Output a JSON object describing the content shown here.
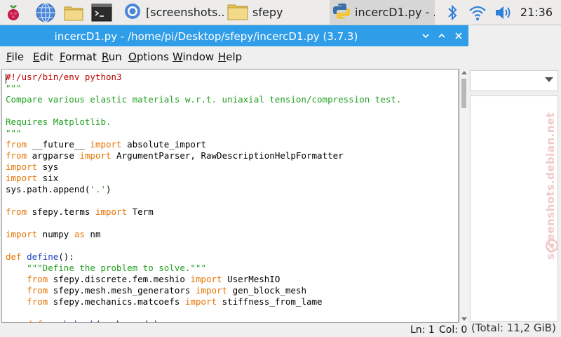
{
  "taskbar": {
    "tasks": [
      {
        "label": "[screenshots....",
        "icon": "chromium-icon"
      },
      {
        "label": "sfepy",
        "icon": "folder-icon"
      },
      {
        "label": "incercD1.py - ...",
        "icon": "python-icon"
      }
    ],
    "clock": "21:36",
    "launchers": [
      "raspberry-menu-icon",
      "web-browser-icon",
      "file-manager-icon",
      "terminal-icon"
    ],
    "tray": [
      "bluetooth-icon",
      "wifi-icon",
      "volume-icon"
    ]
  },
  "window": {
    "title": "incercD1.py - /home/pi/Desktop/sfepy/incercD1.py (3.7.3)",
    "menu": [
      {
        "label": "File",
        "key": "F",
        "rest": "ile"
      },
      {
        "label": "Edit",
        "key": "E",
        "rest": "dit"
      },
      {
        "label": "Format",
        "key": "F",
        "rest": "ormat"
      },
      {
        "label": "Run",
        "key": "R",
        "rest": "un"
      },
      {
        "label": "Options",
        "key": "O",
        "rest": "ptions"
      },
      {
        "label": "Window",
        "key": "W",
        "rest": "indow"
      },
      {
        "label": "Help",
        "key": "H",
        "rest": "elp"
      }
    ],
    "status": {
      "line": "Ln: 1",
      "col": "Col: 0"
    }
  },
  "editor": {
    "lines": [
      [
        [
          "cm",
          "#!/usr/bin/env python3"
        ]
      ],
      [
        [
          "st",
          "\"\"\""
        ]
      ],
      [
        [
          "st",
          "Compare various elastic materials w.r.t. uniaxial tension/compression test."
        ]
      ],
      [],
      [
        [
          "st",
          "Requires Matplotlib."
        ]
      ],
      [
        [
          "st",
          "\"\"\""
        ]
      ],
      [
        [
          "kw",
          "from"
        ],
        [
          "",
          " __future__ "
        ],
        [
          "kw",
          "import"
        ],
        [
          "",
          " absolute_import"
        ]
      ],
      [
        [
          "kw",
          "from"
        ],
        [
          "",
          " argparse "
        ],
        [
          "kw",
          "import"
        ],
        [
          "",
          " ArgumentParser, RawDescriptionHelpFormatter"
        ]
      ],
      [
        [
          "kw",
          "import"
        ],
        [
          "",
          " sys"
        ]
      ],
      [
        [
          "kw",
          "import"
        ],
        [
          "",
          " six"
        ]
      ],
      [
        [
          "",
          "sys.path.append("
        ],
        [
          "st",
          "'.'"
        ],
        [
          "",
          ")"
        ]
      ],
      [],
      [
        [
          "kw",
          "from"
        ],
        [
          "",
          " sfepy.terms "
        ],
        [
          "kw",
          "import"
        ],
        [
          "",
          " Term"
        ]
      ],
      [],
      [
        [
          "kw",
          "import"
        ],
        [
          "",
          " numpy "
        ],
        [
          "kw",
          "as"
        ],
        [
          "",
          " nm"
        ]
      ],
      [],
      [
        [
          "kw",
          "def"
        ],
        [
          "",
          " "
        ],
        [
          "fn",
          "define"
        ],
        [
          "",
          "():"
        ]
      ],
      [
        [
          "",
          "    "
        ],
        [
          "st",
          "\"\"\"Define the problem to solve.\"\"\""
        ]
      ],
      [
        [
          "",
          "    "
        ],
        [
          "kw",
          "from"
        ],
        [
          "",
          " sfepy.discrete.fem.meshio "
        ],
        [
          "kw",
          "import"
        ],
        [
          "",
          " UserMeshIO"
        ]
      ],
      [
        [
          "",
          "    "
        ],
        [
          "kw",
          "from"
        ],
        [
          "",
          " sfepy.mesh.mesh_generators "
        ],
        [
          "kw",
          "import"
        ],
        [
          "",
          " gen_block_mesh"
        ]
      ],
      [
        [
          "",
          "    "
        ],
        [
          "kw",
          "from"
        ],
        [
          "",
          " sfepy.mechanics.matcoefs "
        ],
        [
          "kw",
          "import"
        ],
        [
          "",
          " stiffness_from_lame"
        ]
      ],
      [],
      [
        [
          "",
          "    "
        ],
        [
          "kw",
          "def"
        ],
        [
          "",
          " "
        ],
        [
          "fn",
          "mesh_hook"
        ],
        [
          "",
          "(mesh, mode):"
        ]
      ]
    ]
  },
  "background_window": {
    "status": "(Total: 11,2 GiB)",
    "watermark": "screenshots.debian.net"
  }
}
